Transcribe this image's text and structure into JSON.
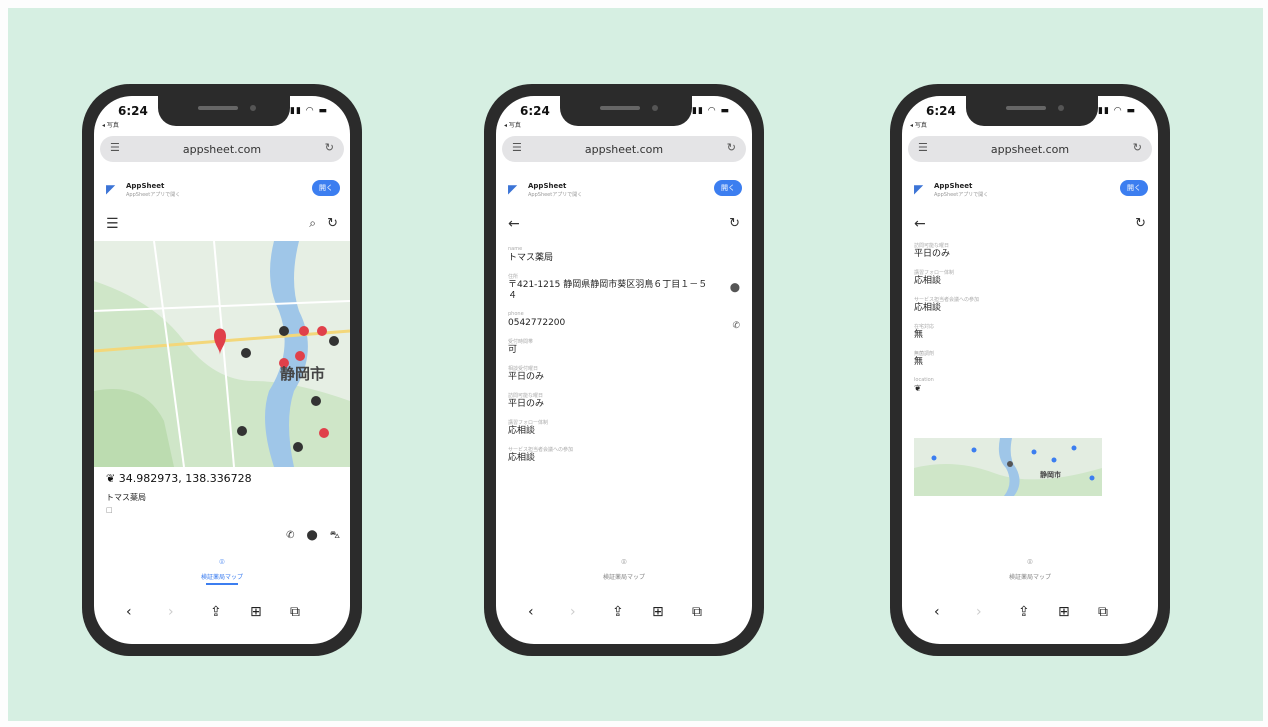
{
  "colors": {
    "background": "#d6efe2",
    "phone": "#2b2b2b",
    "accent": "#3c7ef0",
    "pin_red": "#e0404a",
    "pin_dark": "#333333"
  },
  "phones": [
    {
      "time": "6:24",
      "back_app": "◂ 写真",
      "url": "appsheet.com",
      "app_name": "AppSheet",
      "app_sub": "AppSheetアプリで開く",
      "open_label": "開く",
      "map_city_label": "静岡市",
      "coords": "34.982973, 138.336728",
      "place_name": "トマス薬局",
      "place_sub": "□",
      "tab_label": "検証薬局マップ"
    },
    {
      "time": "6:24",
      "back_app": "◂ 写真",
      "url": "appsheet.com",
      "app_name": "AppSheet",
      "app_sub": "AppSheetアプリで開く",
      "open_label": "開く",
      "fields": [
        {
          "label": "name",
          "value": "トマス薬局"
        },
        {
          "label": "住所",
          "value": "〒421-1215 静岡県静岡市葵区羽鳥６丁目１－５４"
        },
        {
          "label": "phone",
          "value": "0542772200"
        },
        {
          "label": "受付時間帯",
          "value": "可"
        },
        {
          "label": "相談受付曜日",
          "value": "平日のみ"
        },
        {
          "label": "訪問可能な曜日",
          "value": "平日のみ"
        },
        {
          "label": "講習フォロー体制",
          "value": "応相談"
        },
        {
          "label": "サービス担当者会議への参加",
          "value": "応相談"
        }
      ],
      "tab_label": "検証薬局マップ"
    },
    {
      "time": "6:24",
      "back_app": "◂ 写真",
      "url": "appsheet.com",
      "app_name": "AppSheet",
      "app_sub": "AppSheetアプリで開く",
      "open_label": "開く",
      "fields": [
        {
          "label": "訪問可能な曜日",
          "value": "平日のみ"
        },
        {
          "label": "講習フォロー体制",
          "value": "応相談"
        },
        {
          "label": "サービス担当者会議への参加",
          "value": "応相談"
        },
        {
          "label": "在宅対応",
          "value": "無"
        },
        {
          "label": "無菌調剤",
          "value": "無"
        },
        {
          "label": "location",
          "value": ""
        }
      ],
      "map_city_label": "静岡市",
      "tab_label": "検証薬局マップ"
    }
  ]
}
